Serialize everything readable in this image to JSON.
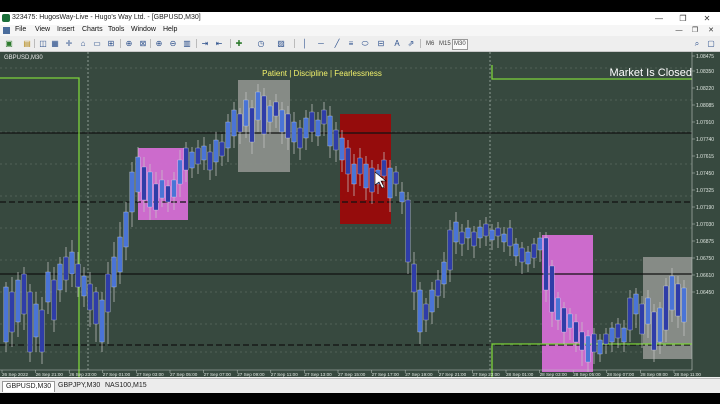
{
  "window": {
    "title": "323475: HugosWay-Live - Hugo's Way Ltd. - [GBPUSD,M30]",
    "controls": [
      "—",
      "❐",
      "✕"
    ]
  },
  "menu": [
    "File",
    "View",
    "Insert",
    "Charts",
    "Tools",
    "Window",
    "Help"
  ],
  "toolbar": {
    "timeframes": [
      "M6",
      "M15",
      "M30"
    ],
    "selected_timeframe": "M30"
  },
  "chart": {
    "symbol_label": "GBPUSD,M30",
    "banner": "Patient | Discipline | Fearlessness",
    "market_status": "Market Is Closed",
    "colors": {
      "background": "#37493f",
      "bull_candle": "#4a74d6",
      "bear_candle": "#2f3da8",
      "zone_pink": "#d46ed4",
      "zone_red": "#9a0a0a",
      "zone_gray": "#8a8f8a",
      "level_line": "#7cd33a"
    },
    "price_labels": [
      "1.08475",
      "1.08350",
      "1.08220",
      "1.08085",
      "1.07910",
      "1.07740",
      "1.07615",
      "1.07450",
      "1.07325",
      "1.07190",
      "1.07030",
      "1.06875",
      "1.06750",
      "1.06610",
      "1.06450"
    ],
    "time_labels": [
      "26 Sep 2022",
      "26 Sep 21:00",
      "26 Sep 23:00",
      "27 Sep 01:00",
      "27 Sep 03:00",
      "27 Sep 05:00",
      "27 Sep 07:00",
      "27 Sep 09:00",
      "27 Sep 11:00",
      "27 Sep 13:00",
      "27 Sep 15:00",
      "27 Sep 17:00",
      "27 Sep 19:00",
      "27 Sep 21:00",
      "27 Sep 23:00",
      "28 Sep 01:00",
      "28 Sep 03:00",
      "28 Sep 05:00",
      "28 Sep 07:00",
      "28 Sep 09:00",
      "28 Sep 11:00"
    ]
  },
  "tabs": [
    "GBPUSD,M30",
    "GBPJPY,M30",
    "NAS100,M15"
  ],
  "active_tab": "GBPUSD,M30"
}
